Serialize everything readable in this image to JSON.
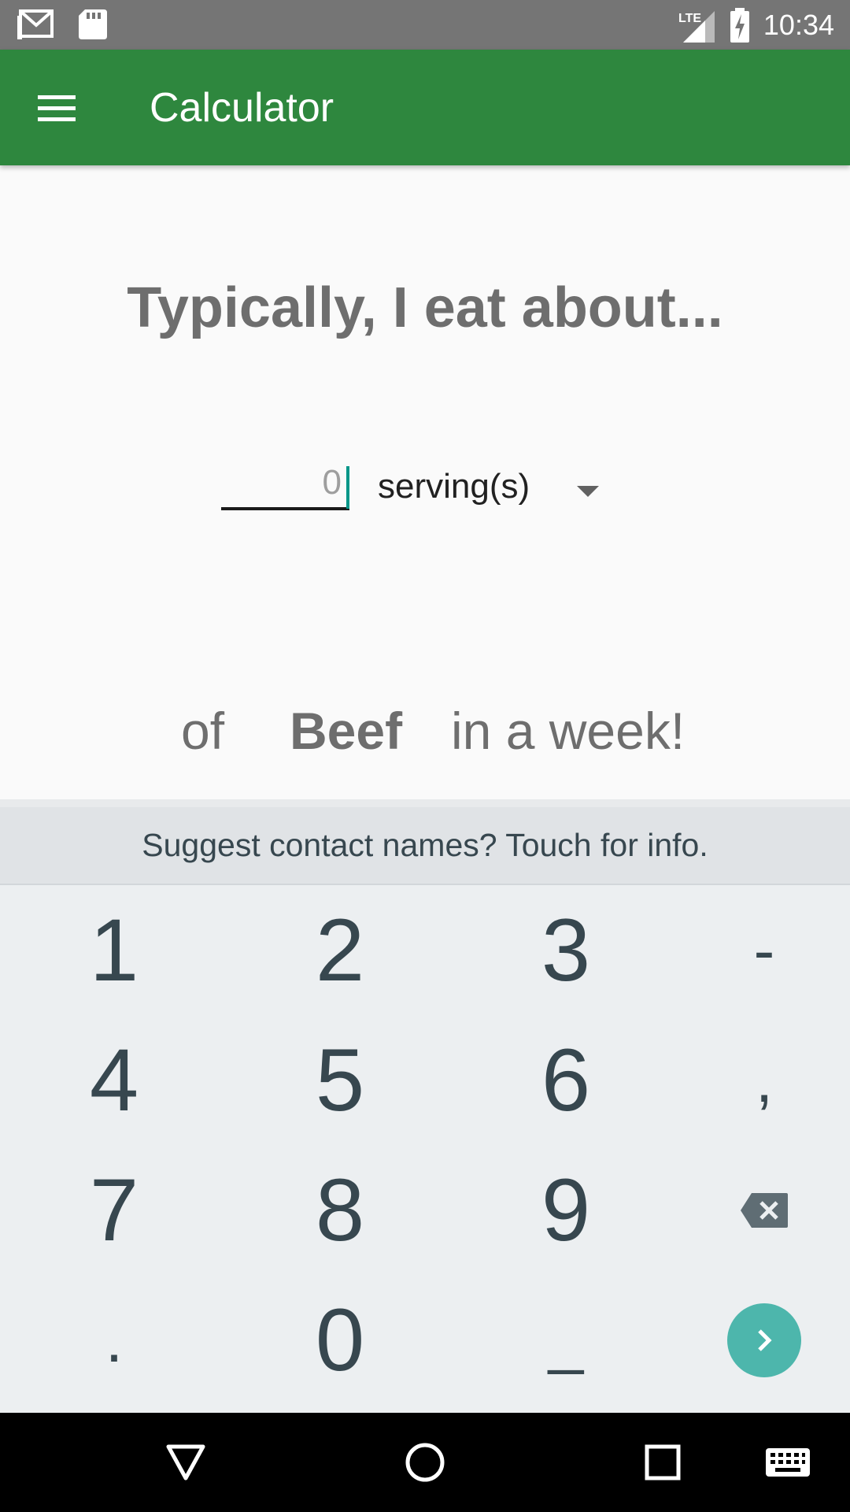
{
  "status_bar": {
    "time": "10:34",
    "network": "LTE",
    "icons": [
      "gmail-icon",
      "sd-card-icon",
      "lte-signal-icon",
      "battery-charging-icon"
    ]
  },
  "app_bar": {
    "title": "Calculator",
    "color": "#2e873e"
  },
  "main": {
    "headline": "Typically, I eat about...",
    "amount_placeholder": "0",
    "unit": "serving(s)",
    "sentence": {
      "prefix": "of",
      "food": "Beef",
      "suffix": "in a week!"
    }
  },
  "keyboard": {
    "suggestion": "Suggest contact names? Touch for info.",
    "keys": [
      [
        "1",
        "2",
        "3",
        "-"
      ],
      [
        "4",
        "5",
        "6",
        ","
      ],
      [
        "7",
        "8",
        "9",
        "backspace"
      ],
      [
        ".",
        "0",
        "_",
        "enter"
      ]
    ],
    "accent": "#4db6ac"
  },
  "nav_bar": {
    "buttons": [
      "back-icon",
      "home-icon",
      "recents-icon",
      "keyboard-icon"
    ]
  }
}
